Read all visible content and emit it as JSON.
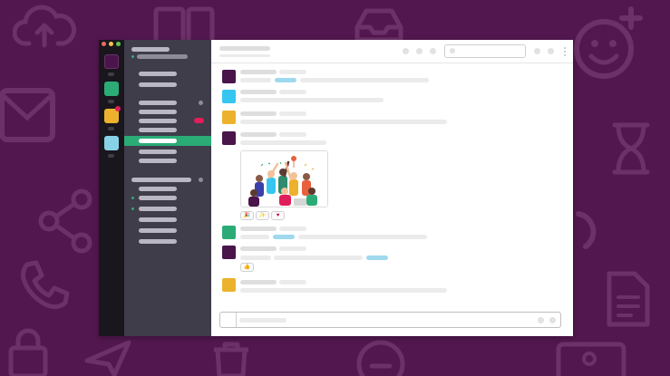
{
  "colors": {
    "background": "#52174f",
    "background_icon": "#5e2a5b",
    "rail": "#19171d",
    "sidebar": "#3f3d4a",
    "active_channel": "#2bac76",
    "badge": "#e01e5a",
    "link_highlight": "#9fd9ee",
    "workspace_icons": [
      "#4a154b",
      "#2bac76",
      "#ecb22e",
      "#88d2e8"
    ],
    "message_avatars": [
      "#4a154b",
      "#36c5f0",
      "#ecb22e",
      "#4a154b",
      "#2bac76",
      "#4a154b",
      "#ecb22e"
    ],
    "window_controls": [
      "#ed6a5e",
      "#f5bf4f",
      "#62c554"
    ]
  },
  "background_icons": [
    "cloud-upload-icon",
    "clipboard-icon",
    "inbox-icon",
    "emoji-add-icon",
    "mail-icon",
    "hourglass-icon",
    "share-icon",
    "phone-icon",
    "document-icon",
    "lock-icon",
    "send-icon",
    "trash-icon",
    "image-icon",
    "emoji-icon",
    "at-sign-icon"
  ],
  "message_reactions": [
    "🎉",
    "✨",
    "♥"
  ],
  "second_reaction": "👍"
}
